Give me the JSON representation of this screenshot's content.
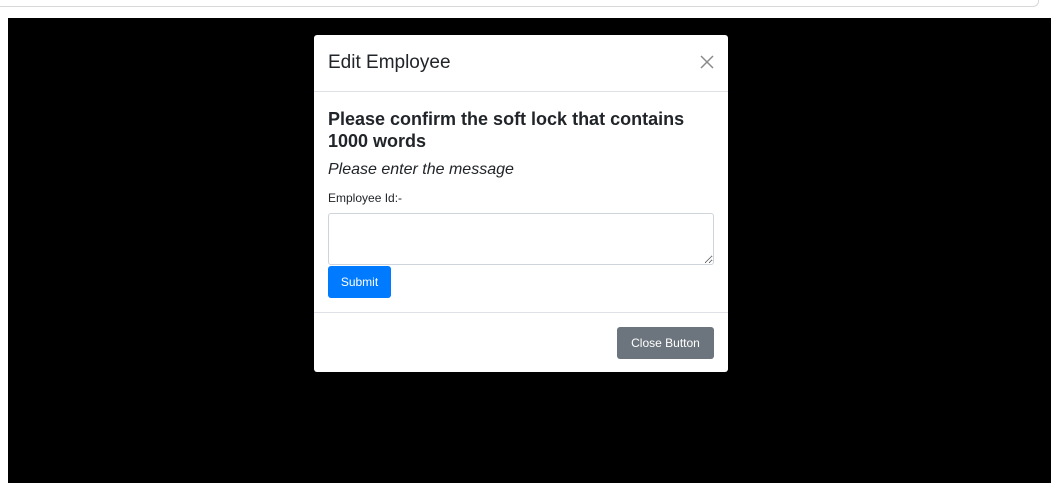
{
  "modal": {
    "title": "Edit Employee",
    "close_icon": "close-icon",
    "heading": "Please confirm the soft lock that contains 1000 words",
    "subheading": "Please enter the message",
    "field_label": "Employee Id:-",
    "message_value": "",
    "submit_label": "Submit",
    "close_button_label": "Close Button"
  },
  "colors": {
    "backdrop": "#000000",
    "primary": "#007bff",
    "secondary": "#6c757d"
  }
}
